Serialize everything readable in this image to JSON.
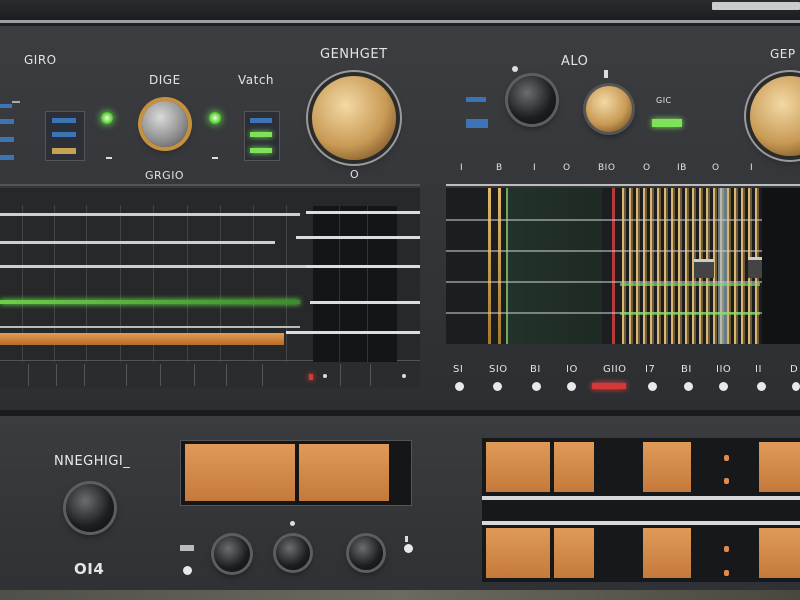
{
  "top": {
    "labels": {
      "left": "GIRO",
      "dige": "DIGE",
      "vatch": "Vatch",
      "center": "GENHGET",
      "alo": "ALO",
      "right": "GEP",
      "under_knob": "GRGIO",
      "zero": "O",
      "small_tag": "GIC"
    },
    "scale_marks": [
      "I",
      "B",
      "I",
      "O",
      "BIO",
      "O",
      "IB",
      "O",
      "I"
    ],
    "bottom_labels": [
      "SI",
      "SIO",
      "BI",
      "IO",
      "GIIO",
      "I7",
      "BI",
      "IIO",
      "II",
      "D"
    ]
  },
  "bottom": {
    "labels": {
      "title": "NNEGHIGI_",
      "code": "OI4"
    }
  },
  "colors": {
    "panel": "#3b3d41",
    "gold": "#c89a55",
    "led_green": "#5bd23a",
    "indicator_blue": "#3d74b8",
    "indicator_red": "#d23a3a",
    "meter_orange": "#e09a58"
  }
}
